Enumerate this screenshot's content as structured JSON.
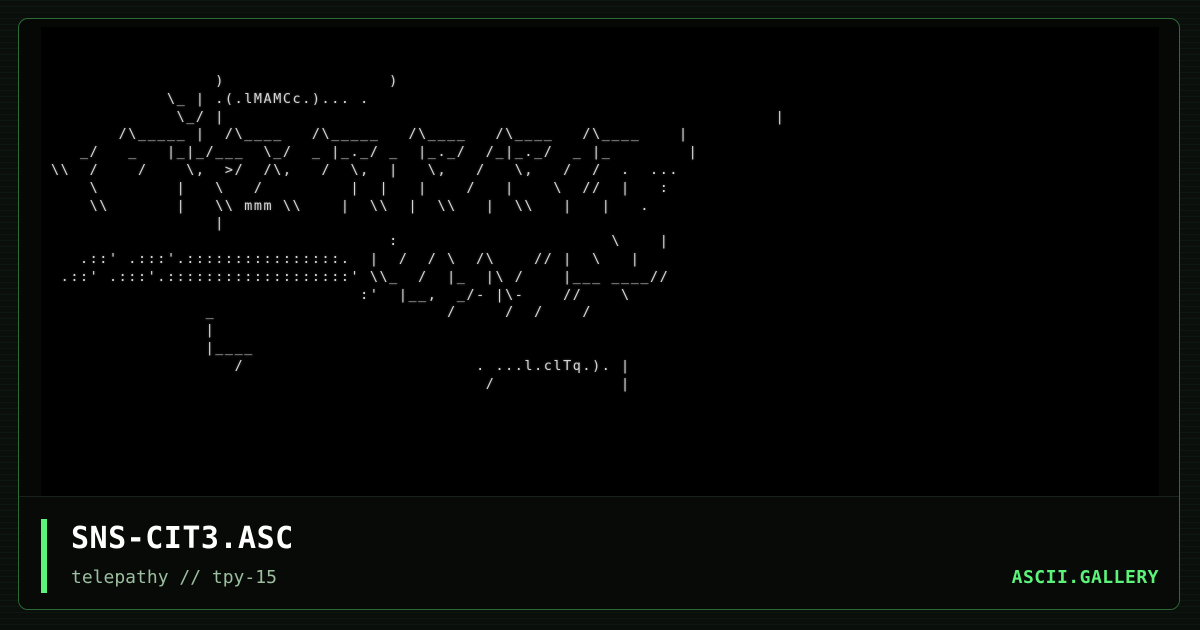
{
  "ascii_art": "                 )                 )\n            \\_ | .(.lMAMCc.)... .\n             \\_/ |                                                         |\n       /\\_____ |  /\\____   /\\_____   /\\____   /\\____   /\\____    |\n   _/   _   |_|_/___  \\_/  _ |_._/ _  |_._/  /_|_._/  _ |_        |\n\\\\  /    /    \\,  >/  /\\,   /  \\,  |   \\,   /   \\,   /  /  .  ...\n    \\        |   \\   /         |  |   |    /   |    \\  //  |   :\n    \\\\       |   \\\\ mmm \\\\    |  \\\\  |  \\\\   |  \\\\   |   |   .\n                 |\n                                   :                      \\    |\n   .::' .:::'.::::::::::::::::.  |  /  / \\  /\\    // |  \\   |\n .::' .:::'.:::::::::::::::::::' \\\\_  /  |_  |\\ /    |___ ____//\n                                :'  |__,  _/- |\\-    //    \\\n                _                        /     /  /    /\n                |\n                |____\n                   /                        . ...l.clTq.). |\n                                             /             |",
  "caption": {
    "title": "SNS-CIT3.ASC",
    "subtitle": "telepathy // tpy-15",
    "brand": "ASCII.GALLERY"
  },
  "colors": {
    "accent": "#5cf37a",
    "border": "#2b6b36",
    "art_background": "#000000",
    "art_text": "#d6d6d6"
  }
}
